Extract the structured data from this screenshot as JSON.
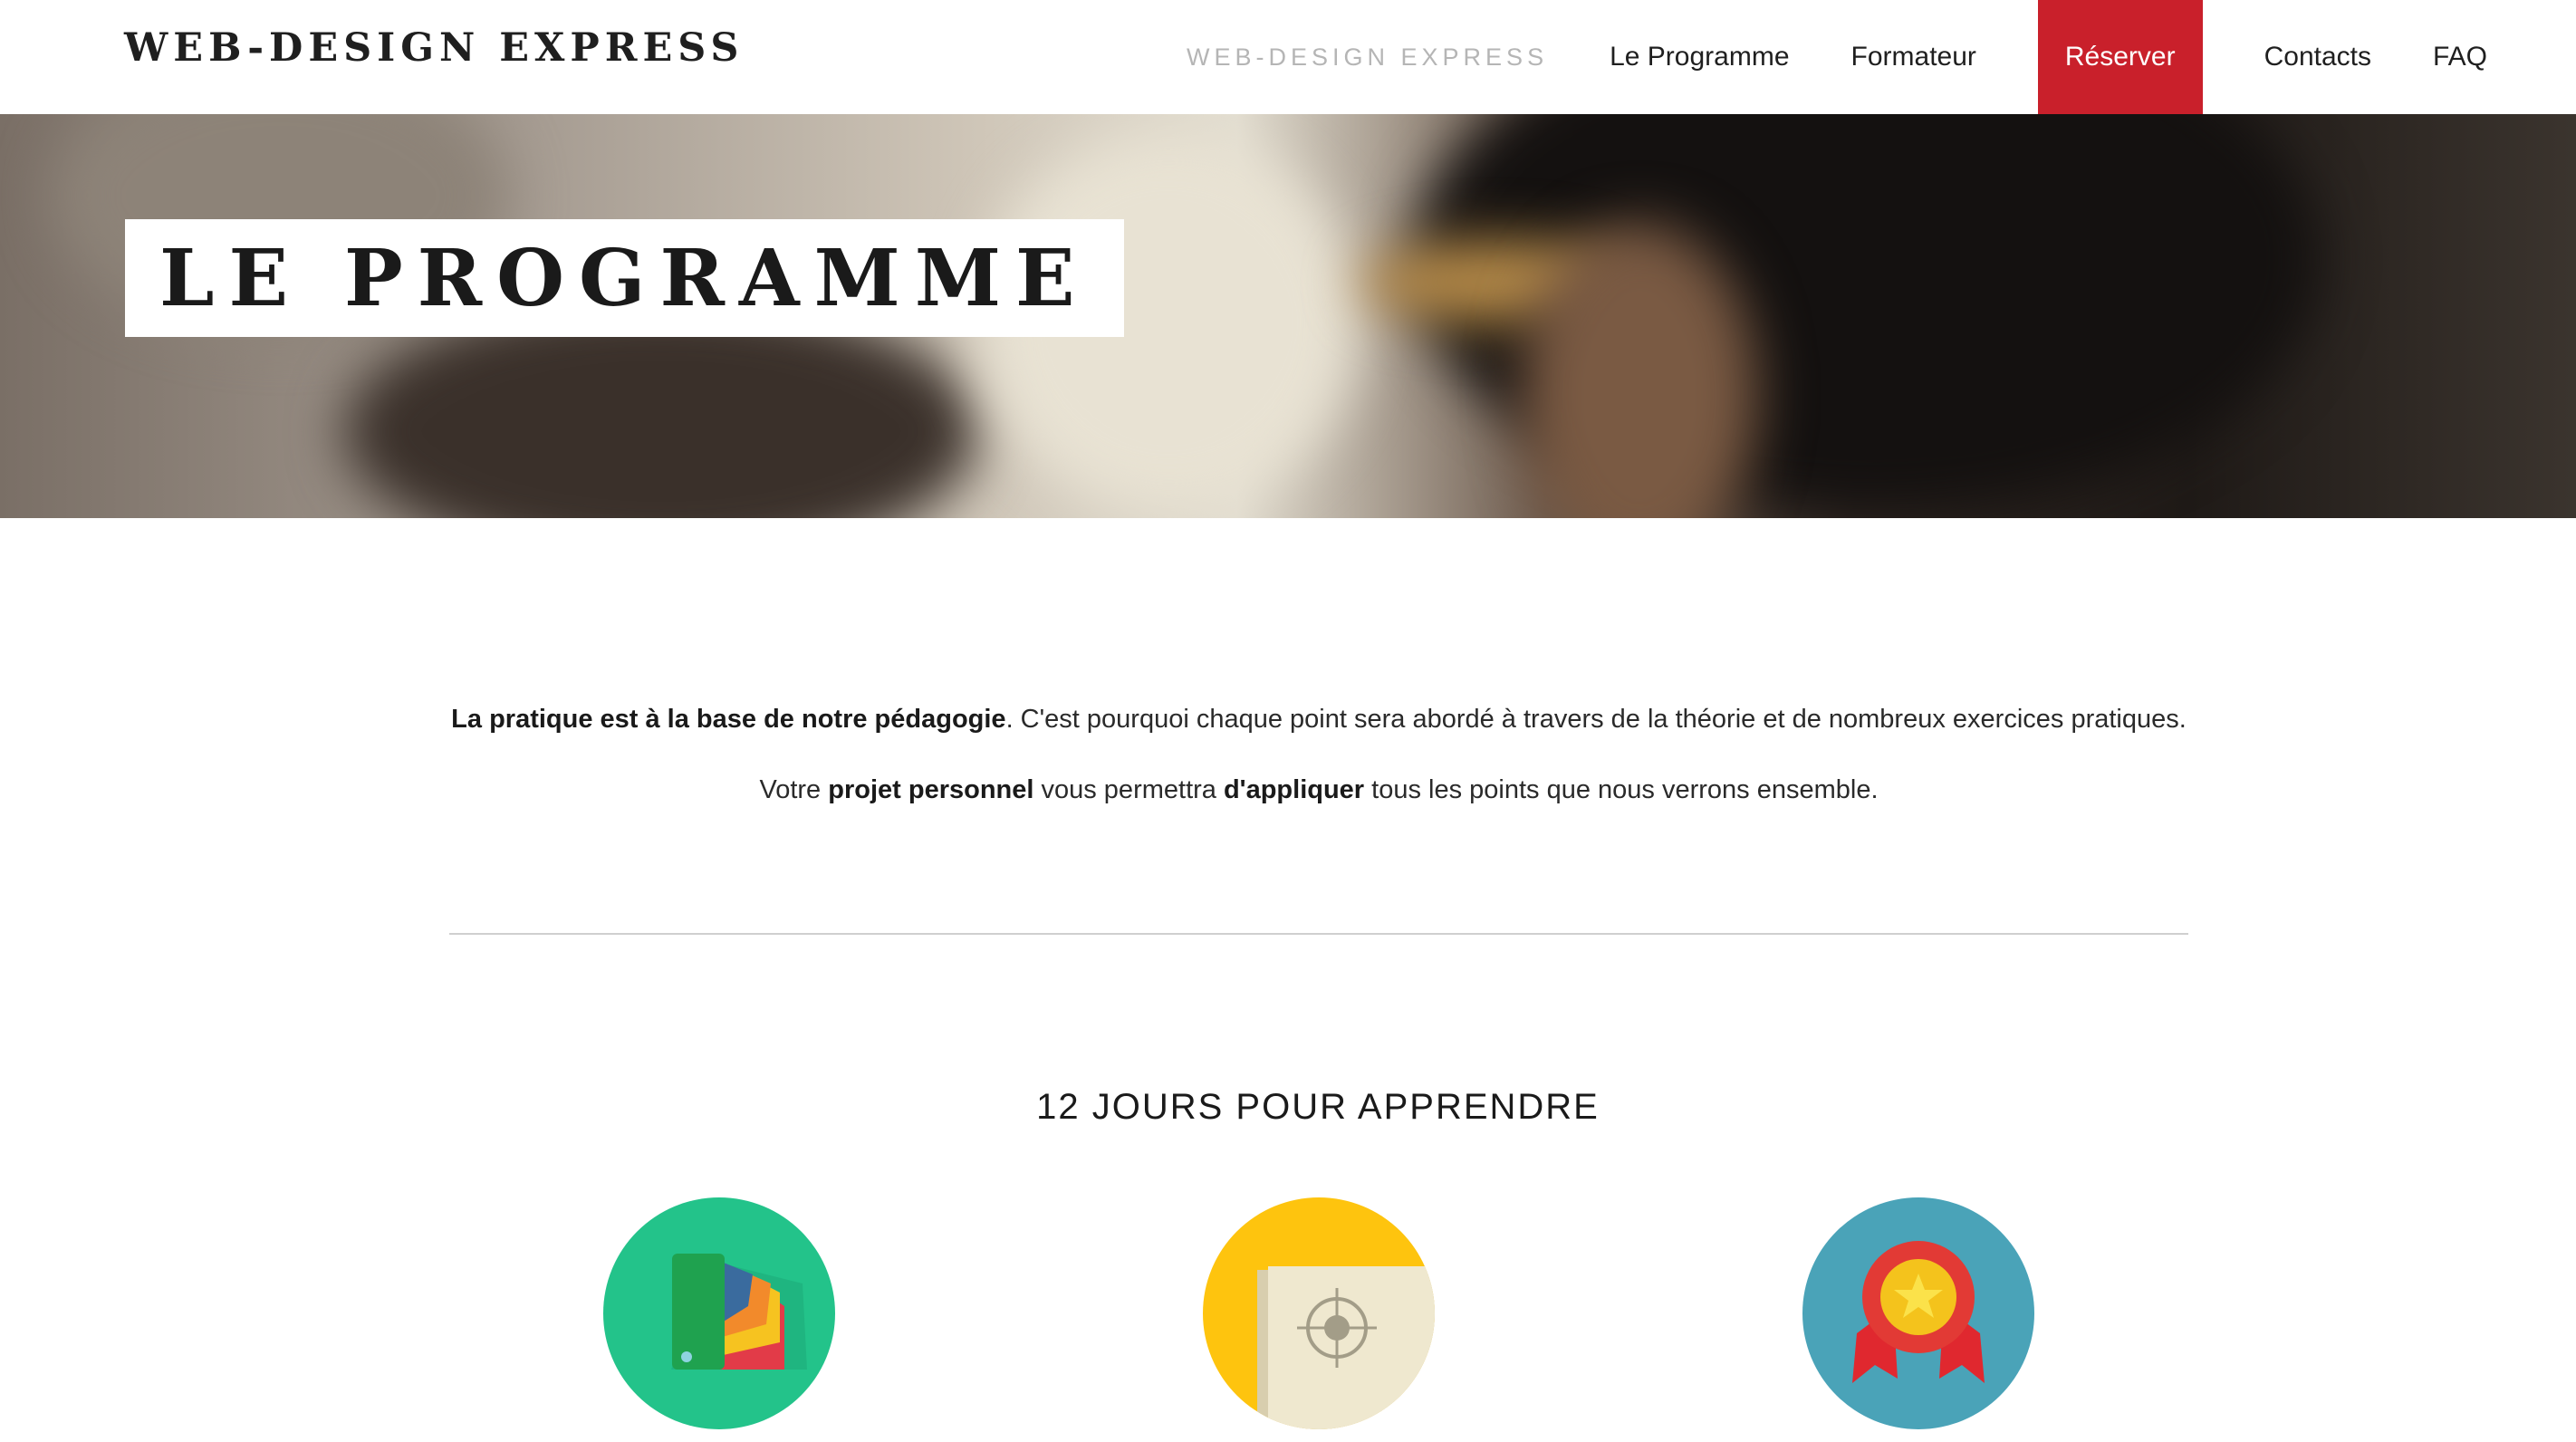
{
  "header": {
    "logo": "WEB-DESIGN EXPRESS",
    "nav": [
      {
        "label": "WEB-DESIGN EXPRESS"
      },
      {
        "label": "Le Programme"
      },
      {
        "label": "Formateur"
      },
      {
        "label": "Réserver"
      },
      {
        "label": "Contacts"
      },
      {
        "label": "FAQ"
      }
    ]
  },
  "hero": {
    "title": "LE PROGRAMME"
  },
  "intro": {
    "p1_bold": "La pratique est à la base de notre pédagogie",
    "p1_rest": ". C'est pourquoi chaque point sera abordé à travers de la théorie et de nombreux exercices pratiques.",
    "p2_a": "Votre ",
    "p2_b": "projet personnel",
    "p2_c": " vous permettra ",
    "p2_d": "d'appliquer",
    "p2_e": " tous les points que nous verrons ensemble."
  },
  "section": {
    "title": "12 JOURS POUR APPRENDRE"
  },
  "features": [
    {
      "icon": "color-swatch-icon",
      "color": "#23c38a"
    },
    {
      "icon": "target-document-icon",
      "color": "#fec40e"
    },
    {
      "icon": "award-medal-icon",
      "color": "#4aa3b8"
    }
  ],
  "colors": {
    "accent": "#c9202b",
    "nav_muted": "#b5b5b5",
    "divider": "#cfcfcf"
  }
}
